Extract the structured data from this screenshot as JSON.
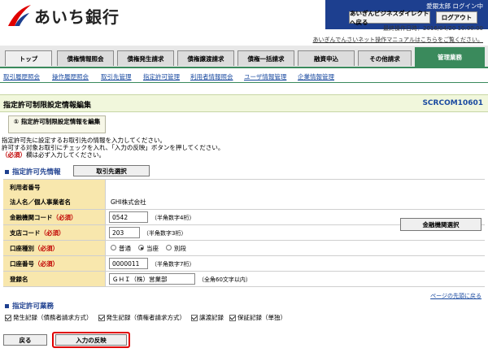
{
  "header": {
    "bank_name": "あいち銀行",
    "user": "愛銀太郎 ログイン中",
    "ab_direct_button": "あいぎんビジネスダイレクトへ戻る",
    "logout_button": "ログアウト",
    "last_login": "最終操作日時：2016/04/20 10:00:00",
    "manual_link": "あいぎんでんさいネット操作マニュアルはこちらをご覧ください。"
  },
  "tabs": [
    "トップ",
    "債権情報照会",
    "債権発生請求",
    "債権譲渡請求",
    "債権一括請求",
    "融資申込",
    "その他請求",
    "管理業務"
  ],
  "subnav": [
    "取引履歴照会",
    "操作履歴照会",
    "取引先管理",
    "指定許可管理",
    "利用者情報照会",
    "ユーザ情報管理",
    "企業情報管理"
  ],
  "page": {
    "title": "指定許可制限設定情報編集",
    "code": "SCRCOM10601",
    "step_label": "① 指定許可制限設定情報を編集",
    "instruction1": "指定許可先に設定するお取引先の情報を入力してください。",
    "instruction2": "許可する対象お取引にチェックを入れ、「入力の反映」ボタンを押してください。",
    "instruction3_req": "（必須）",
    "instruction3": "欄は必ず入力してください。"
  },
  "section1": {
    "heading": "指定許可先情報",
    "select_button": "取引先選択"
  },
  "form": {
    "user_no_label": "利用者番号",
    "user_no_value": "",
    "corp_name_label": "法人名／個人事業者名",
    "corp_name_value": "GHI株式会社",
    "bank_code_label": "金融機関コード",
    "bank_code_req": "（必須）",
    "bank_code_value": "0542",
    "bank_code_hint": "（半角数字4桁）",
    "branch_code_label": "支店コード",
    "branch_code_req": "（必須）",
    "branch_code_value": "203",
    "branch_code_hint": "（半角数字3桁）",
    "bank_select_button": "金融機関選択",
    "account_type_label": "口座種別",
    "account_type_req": "（必須）",
    "account_types": [
      "普通",
      "当座",
      "別段"
    ],
    "account_type_selected": "当座",
    "account_no_label": "口座番号",
    "account_no_req": "（必須）",
    "account_no_value": "0000011",
    "account_no_hint": "（半角数字7桁）",
    "reg_name_label": "登録名",
    "reg_name_value": "ＧＨＩ（株）営業部",
    "reg_name_hint": "（全角60文字以内）"
  },
  "page_top_link": "ページの先頭に戻る",
  "section2": {
    "heading": "指定許可業務",
    "checkboxes": [
      {
        "label": "発生記録（債務者請求方式）",
        "checked": true
      },
      {
        "label": "発生記録（債権者請求方式）",
        "checked": true
      },
      {
        "label": "譲渡記録",
        "checked": true
      },
      {
        "label": "保証記録（単独）",
        "checked": true
      }
    ]
  },
  "footer": {
    "back_button": "戻る",
    "apply_button": "入力の反映"
  },
  "colors": {
    "brand_blue": "#1d3f8f",
    "active_tab_green": "#3a8a5c",
    "label_bg": "#f8e7ad",
    "required_red": "#c00000",
    "highlight_red": "#e00000"
  }
}
